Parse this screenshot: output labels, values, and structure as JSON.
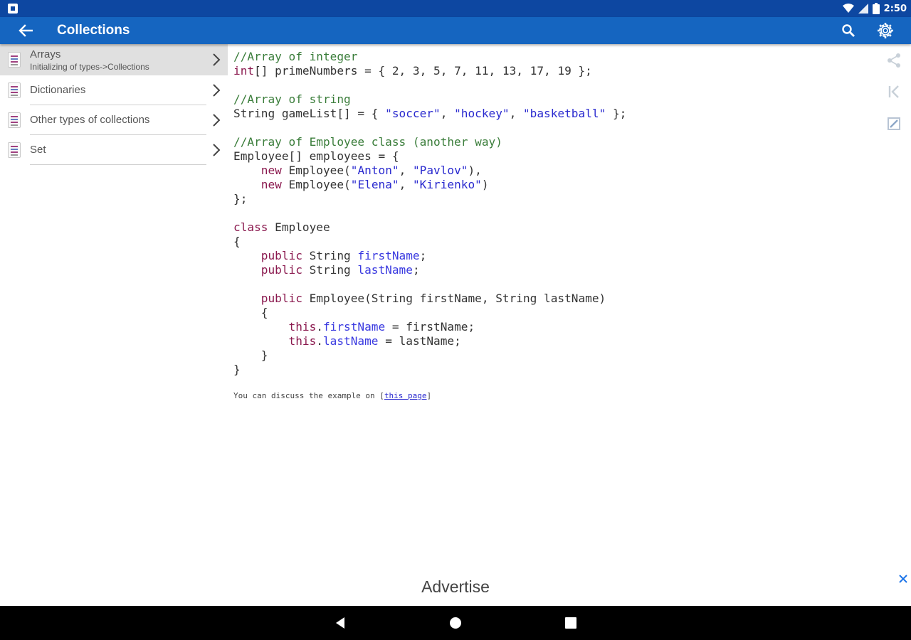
{
  "status_bar": {
    "time": "2:50",
    "icons": [
      "notification-icon",
      "wifi-icon",
      "signal-icon",
      "battery-icon"
    ]
  },
  "toolbar": {
    "title": "Collections",
    "icons": [
      "back-arrow-icon",
      "search-icon",
      "gear-icon"
    ]
  },
  "sidebar": {
    "items": [
      {
        "label": "Arrays",
        "sub": "Initializing of types->Collections",
        "selected": true
      },
      {
        "label": "Dictionaries",
        "sub": ""
      },
      {
        "label": "Other types of collections",
        "sub": ""
      },
      {
        "label": "Set",
        "sub": ""
      }
    ]
  },
  "code": {
    "lines": [
      [
        [
          "c-com",
          "//Array of integer"
        ]
      ],
      [
        [
          "c-kw",
          "int"
        ],
        [
          "",
          "[] primeNumbers = { 2, 3, 5, 7, 11, 13, 17, 19 };"
        ]
      ],
      [
        [
          "",
          ""
        ]
      ],
      [
        [
          "c-com",
          "//Array of string"
        ]
      ],
      [
        [
          "",
          "String gameList[] = { "
        ],
        [
          "c-str",
          "\"soccer\""
        ],
        [
          "",
          ", "
        ],
        [
          "c-str",
          "\"hockey\""
        ],
        [
          "",
          ", "
        ],
        [
          "c-str",
          "\"basketball\""
        ],
        [
          "",
          " };"
        ]
      ],
      [
        [
          "",
          ""
        ]
      ],
      [
        [
          "c-com",
          "//Array of Employee class (another way)"
        ]
      ],
      [
        [
          "",
          "Employee[] employees = {"
        ]
      ],
      [
        [
          "",
          "    "
        ],
        [
          "c-kw",
          "new"
        ],
        [
          "",
          " Employee("
        ],
        [
          "c-str",
          "\"Anton\""
        ],
        [
          "",
          ", "
        ],
        [
          "c-str",
          "\"Pavlov\""
        ],
        [
          "",
          "),"
        ]
      ],
      [
        [
          "",
          "    "
        ],
        [
          "c-kw",
          "new"
        ],
        [
          "",
          " Employee("
        ],
        [
          "c-str",
          "\"Elena\""
        ],
        [
          "",
          ", "
        ],
        [
          "c-str",
          "\"Kirienko\""
        ],
        [
          "",
          ")"
        ]
      ],
      [
        [
          "",
          "};"
        ]
      ],
      [
        [
          "",
          ""
        ]
      ],
      [
        [
          "c-kw",
          "class"
        ],
        [
          "",
          " Employee"
        ]
      ],
      [
        [
          "",
          "{"
        ]
      ],
      [
        [
          "",
          "    "
        ],
        [
          "c-kw",
          "public"
        ],
        [
          "",
          " String "
        ],
        [
          "c-fld",
          "firstName"
        ],
        [
          "",
          ";"
        ]
      ],
      [
        [
          "",
          "    "
        ],
        [
          "c-kw",
          "public"
        ],
        [
          "",
          " String "
        ],
        [
          "c-fld",
          "lastName"
        ],
        [
          "",
          ";"
        ]
      ],
      [
        [
          "",
          ""
        ]
      ],
      [
        [
          "",
          "    "
        ],
        [
          "c-kw",
          "public"
        ],
        [
          "",
          " Employee(String firstName, String lastName)"
        ]
      ],
      [
        [
          "",
          "    {"
        ]
      ],
      [
        [
          "",
          "        "
        ],
        [
          "c-kw",
          "this"
        ],
        [
          "",
          "."
        ],
        [
          "c-fld",
          "firstName"
        ],
        [
          "",
          " = firstName;"
        ]
      ],
      [
        [
          "",
          "        "
        ],
        [
          "c-kw",
          "this"
        ],
        [
          "",
          "."
        ],
        [
          "c-fld",
          "lastName"
        ],
        [
          "",
          " = lastName;"
        ]
      ],
      [
        [
          "",
          "    }"
        ]
      ],
      [
        [
          "",
          "}"
        ]
      ]
    ]
  },
  "discuss": {
    "prefix": "You can discuss the example on ",
    "link_text": "this page"
  },
  "right_rail": {
    "icons": [
      "share-icon",
      "first-page-icon",
      "edit-note-icon"
    ]
  },
  "ad": {
    "label": "Advertise"
  },
  "navbar": {
    "icons": [
      "nav-back-icon",
      "nav-home-icon",
      "nav-recents-icon"
    ]
  },
  "colors": {
    "status_bar": "#0d47a1",
    "toolbar": "#1565c0",
    "comment": "#3a7d3a",
    "keyword": "#8b1a4f",
    "string": "#2a2acf",
    "selected_row": "#e0e0e0"
  }
}
